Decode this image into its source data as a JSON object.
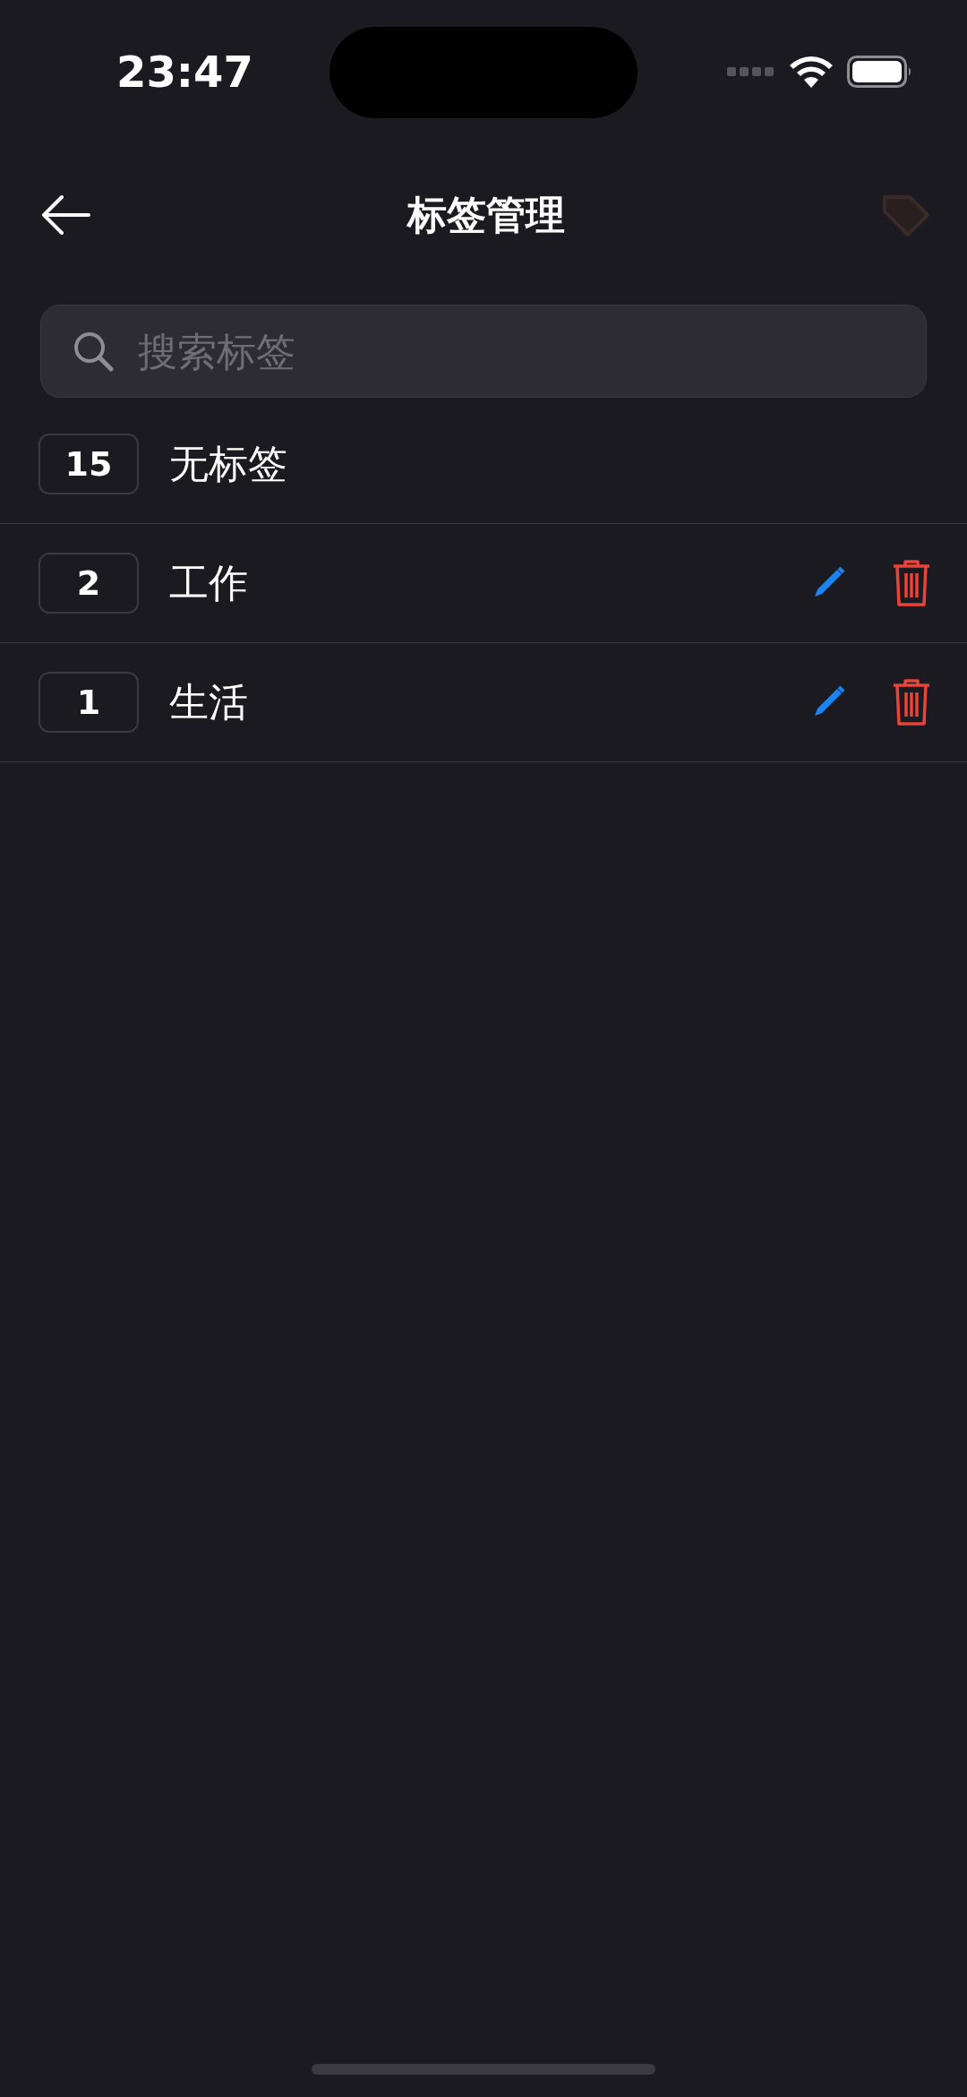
{
  "status_bar": {
    "time": "23:47"
  },
  "header": {
    "title": "标签管理"
  },
  "search": {
    "placeholder": "搜索标签"
  },
  "tags": [
    {
      "count": "15",
      "name": "无标签",
      "editable": false
    },
    {
      "count": "2",
      "name": "工作",
      "editable": true
    },
    {
      "count": "1",
      "name": "生活",
      "editable": true
    }
  ]
}
